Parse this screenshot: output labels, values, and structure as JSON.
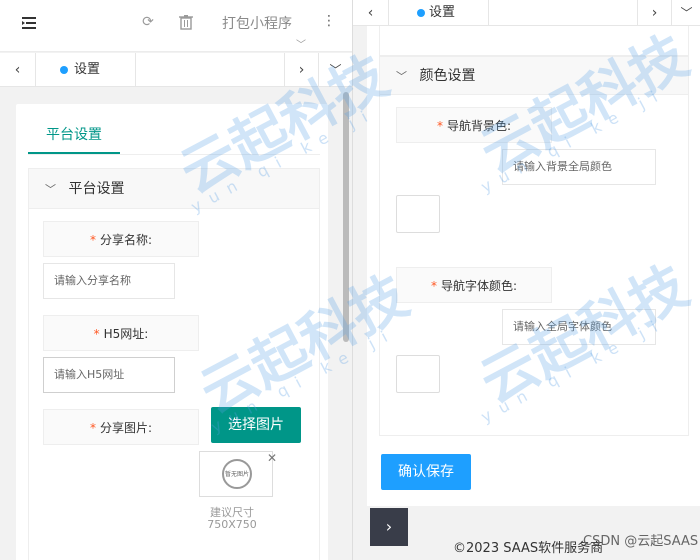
{
  "toolbar": {
    "pack_label": "打包小程序"
  },
  "tabs": {
    "active_label": "设置"
  },
  "left": {
    "card_tab": "平台设置",
    "section_title": "平台设置",
    "share_name_label": "分享名称:",
    "share_name_placeholder": "请输入分享名称",
    "h5_label": "H5网址:",
    "h5_placeholder": "请输入H5网址",
    "share_image_label": "分享图片:",
    "choose_image_button": "选择图片",
    "thumb_text": "暂无图片",
    "hint_line1": "建议尺寸",
    "hint_line2": "750X750"
  },
  "right": {
    "section_title": "颜色设置",
    "nav_bg_label": "导航背景色:",
    "nav_bg_placeholder": "请输入背景全局颜色",
    "nav_font_label": "导航字体颜色:",
    "nav_font_placeholder": "请输入全局字体颜色",
    "save_button": "确认保存",
    "footer": "©2023 SAAS软件服务商",
    "csdn_watermark": "CSDN @云起SAAS"
  },
  "watermark": {
    "brand": "云起科技",
    "pinyin": "yun qi ke ji"
  },
  "colors": {
    "green": "#009688",
    "blue": "#1e9fff",
    "required": "#ff5722"
  }
}
